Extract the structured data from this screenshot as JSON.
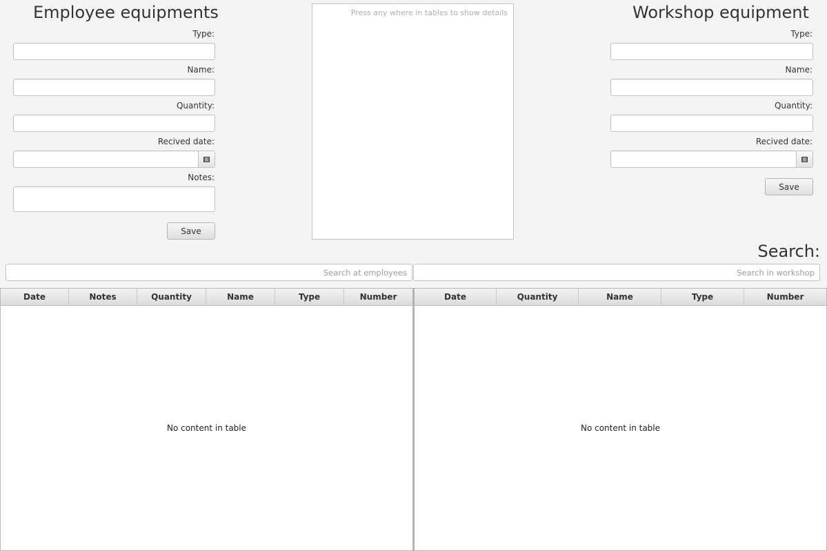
{
  "employee": {
    "title": "Employee equipments",
    "type_label": "Type:",
    "type_value": "",
    "name_label": "Name:",
    "name_value": "",
    "quantity_label": "Quantity:",
    "quantity_value": "",
    "date_label": "Recived date:",
    "date_value": "",
    "notes_label": "Notes:",
    "notes_value": "",
    "save_label": "Save"
  },
  "details": {
    "hint": "Press any where in tables to show details"
  },
  "workshop": {
    "title": "Workshop equipment",
    "type_label": "Type:",
    "type_value": "",
    "name_label": "Name:",
    "name_value": "",
    "quantity_label": "Quantity:",
    "quantity_value": "",
    "date_label": "Recived date:",
    "date_value": "",
    "save_label": "Save"
  },
  "search": {
    "title": "Search:",
    "employees_placeholder": "Search at employees",
    "workshop_placeholder": "Search in workshop"
  },
  "employee_table": {
    "columns": [
      "Date",
      "Notes",
      "Quantity",
      "Name",
      "Type",
      "Number"
    ],
    "empty_text": "No content in table"
  },
  "workshop_table": {
    "columns": [
      "Date",
      "Quantity",
      "Name",
      "Type",
      "Number"
    ],
    "empty_text": "No content in table"
  },
  "icons": {
    "calendar": "calendar-icon"
  }
}
